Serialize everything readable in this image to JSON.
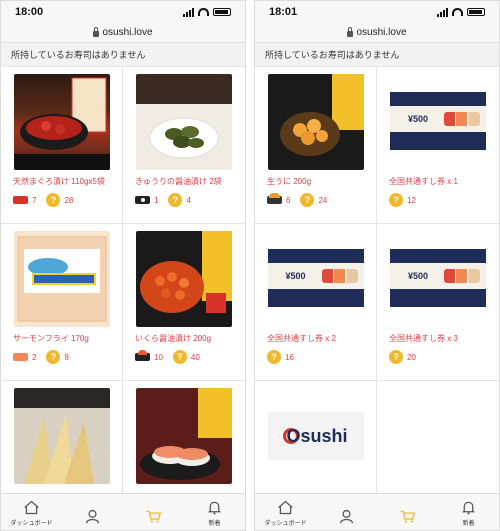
{
  "screens": [
    {
      "time": "18:00",
      "url": "osushi.love",
      "notice": "所持しているお寿司はありません",
      "products": [
        {
          "title": "天然まぐろ漬け 110gx5袋",
          "sushi_icon": "tuna-sushi-icon",
          "pieces": "7",
          "points": "28",
          "image": "maguro-zuke",
          "img_text": "天然まぐろ漬け"
        },
        {
          "title": "きゅうりの醤油漬け 2袋",
          "sushi_icon": "cucumber-roll-icon",
          "pieces": "1",
          "points": "4",
          "image": "cucumber-pickles",
          "img_text": "シャキッとカリッとがたまらない！"
        },
        {
          "title": "サーモンフライ 170g",
          "sushi_icon": "salmon-sushi-icon",
          "pieces": "2",
          "points": "8",
          "image": "salmon-fry",
          "img_text": "サーモンフライ"
        },
        {
          "title": "いくら醤油漬け 200g",
          "sushi_icon": "ikura-gunkan-icon",
          "pieces": "10",
          "points": "40",
          "image": "ikura",
          "img_text": "いくら醤油漬け"
        },
        {
          "title": "",
          "sushi_icon": "",
          "pieces": "",
          "points": "",
          "image": "dried-squid",
          "img_text": "晩酌のお供に…"
        },
        {
          "title": "",
          "sushi_icon": "",
          "pieces": "",
          "points": "",
          "image": "ebi-nigiri",
          "img_text": "開き蒸しえび"
        }
      ]
    },
    {
      "time": "18:01",
      "url": "osushi.love",
      "notice": "所持しているお寿司はありません",
      "products": [
        {
          "title": "生うに 200g",
          "sushi_icon": "uni-gunkan-icon",
          "pieces": "6",
          "points": "24",
          "image": "uni",
          "img_text": "生うに"
        },
        {
          "title": "全国共通すし券 x 1",
          "sushi_icon": "",
          "pieces": "",
          "points": "12",
          "image": "ticket",
          "img_text": "¥500"
        },
        {
          "title": "全国共通すし券 x 2",
          "sushi_icon": "",
          "pieces": "",
          "points": "16",
          "image": "ticket",
          "img_text": "¥500"
        },
        {
          "title": "全国共通すし券 x 3",
          "sushi_icon": "",
          "pieces": "",
          "points": "20",
          "image": "ticket",
          "img_text": "¥500"
        },
        {
          "title": "",
          "sushi_icon": "",
          "pieces": "",
          "points": "",
          "image": "osushi-logo",
          "img_text": "Osushi"
        },
        {
          "title": "",
          "sushi_icon": "",
          "pieces": "",
          "points": "",
          "image": "empty",
          "img_text": ""
        }
      ]
    }
  ],
  "tabs": [
    {
      "label": "ダッシュボード",
      "icon": "home-icon"
    },
    {
      "label": "",
      "icon": "person-icon"
    },
    {
      "label": "",
      "icon": "cart-icon",
      "active": true
    },
    {
      "label": "新着",
      "icon": "bell-icon"
    }
  ],
  "coin_symbol": "?",
  "colors": {
    "accent": "#f1b72d",
    "price_text": "#e0404a",
    "ticket_navy": "#1f2c57"
  }
}
